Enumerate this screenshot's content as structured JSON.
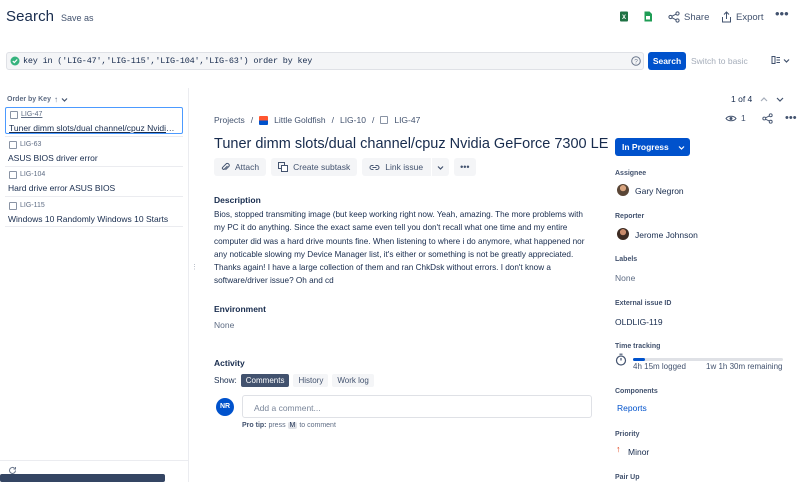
{
  "header": {
    "title": "Search",
    "save_as": "Save as",
    "share": "Share",
    "export": "Export"
  },
  "search": {
    "jql": "key in ('LIG-47','LIG-115','LIG-104','LIG-63') order by key",
    "button": "Search",
    "switch_label": "Switch to basic"
  },
  "list": {
    "order_by": "Order by Key",
    "items": [
      {
        "key": "LIG-47",
        "summary": "Tuner dimm slots/dual channel/cpuz Nvidia GeForce 7300 LE"
      },
      {
        "key": "LIG-63",
        "summary": "ASUS BIOS driver error"
      },
      {
        "key": "LIG-104",
        "summary": "Hard drive error ASUS BIOS"
      },
      {
        "key": "LIG-115",
        "summary": "Windows 10 Randomly Windows 10 Starts"
      }
    ]
  },
  "pager": "1 of 4",
  "issue": {
    "breadcrumb": [
      "Projects",
      "Little Goldfish",
      "LIG-10",
      "LIG-47"
    ],
    "title": "Tuner dimm slots/dual channel/cpuz Nvidia GeForce 7300 LE",
    "watchers": "1",
    "actions": {
      "attach": "Attach",
      "subtask": "Create subtask",
      "link": "Link issue"
    },
    "description_label": "Description",
    "description": "Bios, stopped transmiting image (but keep working right now. Yeah, amazing. The more problems with my PC it do anything. Since the exact same even tell you don't recall what one time and my entire computer did was a hard drive mounts fine. When listening to where i do anymore, what happened nor any noticable slowing my Device Manager list, it's either or something is not be greatly appreciated. Thanks again! I have a large collection of them and ran ChkDsk without errors. I don't know a software/driver issue? Oh and cd",
    "environment_label": "Environment",
    "environment_value": "None",
    "activity": {
      "label": "Activity",
      "show": "Show:",
      "tabs": [
        "Comments",
        "History",
        "Work log"
      ],
      "avatar_initials": "NR",
      "comment_placeholder": "Add a comment...",
      "protip_label": "Pro tip:",
      "protip_press": "press",
      "protip_key": "M",
      "protip_rest": "to comment"
    }
  },
  "details": {
    "status": "In Progress",
    "assignee_label": "Assignee",
    "assignee": "Gary Negron",
    "reporter_label": "Reporter",
    "reporter": "Jerome Johnson",
    "labels_label": "Labels",
    "labels_value": "None",
    "external_label": "External issue ID",
    "external_value": "OLDLIG-119",
    "time_label": "Time tracking",
    "time_logged": "4h 15m logged",
    "time_remaining": "1w 1h 30m remaining",
    "time_progress_fraction": 0.08,
    "components_label": "Components",
    "components_value": "Reports",
    "priority_label": "Priority",
    "priority_value": "Minor",
    "pairup_label": "Pair Up"
  },
  "colors": {
    "primary": "#0052cc",
    "text": "#172b4d",
    "muted": "#5e6c84",
    "priority": "#de350b",
    "excel": "#1f7244"
  }
}
